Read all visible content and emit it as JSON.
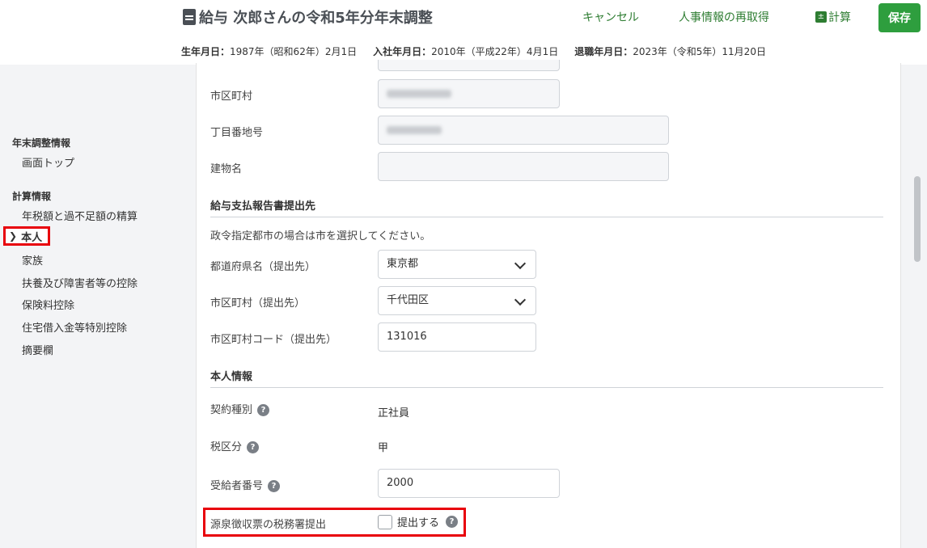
{
  "header": {
    "title": "給与 次郎さんの令和5年分年末調整",
    "cancel_label": "キャンセル",
    "refetch_label": "人事情報の再取得",
    "calc_label": "計算",
    "save_label": "保存",
    "dob_label": "生年月日：",
    "dob_value": "1987年（昭和62年）2月1日",
    "join_label": "入社年月日：",
    "join_value": "2010年（平成22年）4月1日",
    "leave_label": "退職年月日：",
    "leave_value": "2023年（令和5年）11月20日"
  },
  "sidebar": {
    "group1": "年末調整情報",
    "top": "画面トップ",
    "group2": "計算情報",
    "items": [
      "年税額と過不足額の精算",
      "本人",
      "家族",
      "扶養及び障害者等の控除",
      "保険料控除",
      "住宅借入金等特別控除",
      "摘要欄"
    ]
  },
  "form": {
    "city_label": "市区町村",
    "chome_label": "丁目番地号",
    "building_label": "建物名",
    "section_report": "給与支払報告書提出先",
    "report_note": "政令指定都市の場合は市を選択してください。",
    "pref_label": "都道府県名（提出先）",
    "pref_value": "東京都",
    "city_sub_label": "市区町村（提出先）",
    "city_sub_value": "千代田区",
    "city_code_label": "市区町村コード（提出先）",
    "city_code_value": "131016",
    "section_person": "本人情報",
    "contract_label": "契約種別",
    "contract_value": "正社員",
    "tax_label": "税区分",
    "tax_value": "甲",
    "recipient_label": "受給者番号",
    "recipient_value": "2000",
    "withholding_label": "源泉徴収票の税務署提出",
    "submit_label": "提出する"
  }
}
